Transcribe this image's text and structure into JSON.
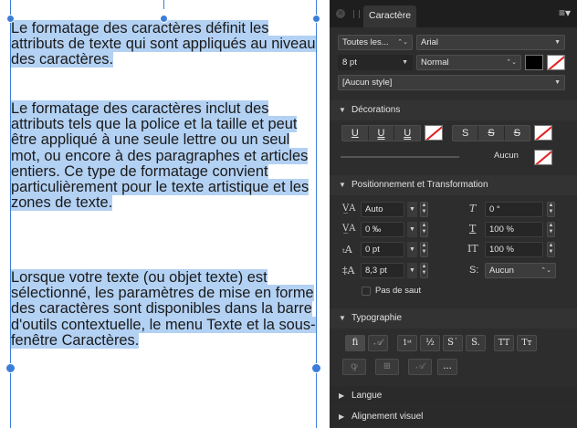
{
  "document": {
    "paragraphs": [
      "Le formatage des caractères définit les attributs de texte qui sont appliqués au niveau des caractères.",
      "Le formatage des caractères inclut des attributs tels que la police et la taille et peut être appliqué à une seule lettre ou un seul mot, ou encore à des paragraphes et articles entiers. Ce type de formatage convient particulièrement pour le texte artistique et les zones de texte.",
      "Lorsque votre texte (ou objet texte) est sélectionné, les paramètres de mise en forme des caractères sont disponibles dans la barre d'outils contextuelle, le menu Texte et la sous-fenêtre Caractères."
    ],
    "selection_color": "#b3d1f3",
    "frame_color": "#3b7dd8"
  },
  "panel": {
    "tab_title": "Caractère",
    "menu_icon": "hamburger-menu-icon",
    "font_collection": "Toutes les...",
    "font_family": "Arial",
    "font_size": "8 pt",
    "font_style": "Normal",
    "text_color": "#000000",
    "style_name": "[Aucun style]",
    "sections": {
      "decorations": "Décorations",
      "position": "Positionnement et Transformation",
      "typography": "Typographie",
      "language": "Langue",
      "visual_alignment": "Alignement visuel"
    },
    "decorations": {
      "underline_buttons": [
        "U",
        "U",
        "U"
      ],
      "strike_buttons": [
        "S",
        "S",
        "S"
      ],
      "line_value": "Aucun"
    },
    "position": {
      "tracking": "Auto",
      "kerning": "0 ‰",
      "baseline": "0 pt",
      "leading": "8,3 pt",
      "shear": "0 °",
      "vertical_scale": "100 %",
      "horizontal_scale": "100 %",
      "caps": "Aucun",
      "no_break_label": "Pas de saut"
    },
    "typography": {
      "row1": [
        "fi",
        "𝒜",
        "1st",
        "½",
        "S•",
        "S.",
        "TT",
        "Tт"
      ],
      "more_label": "..."
    }
  }
}
